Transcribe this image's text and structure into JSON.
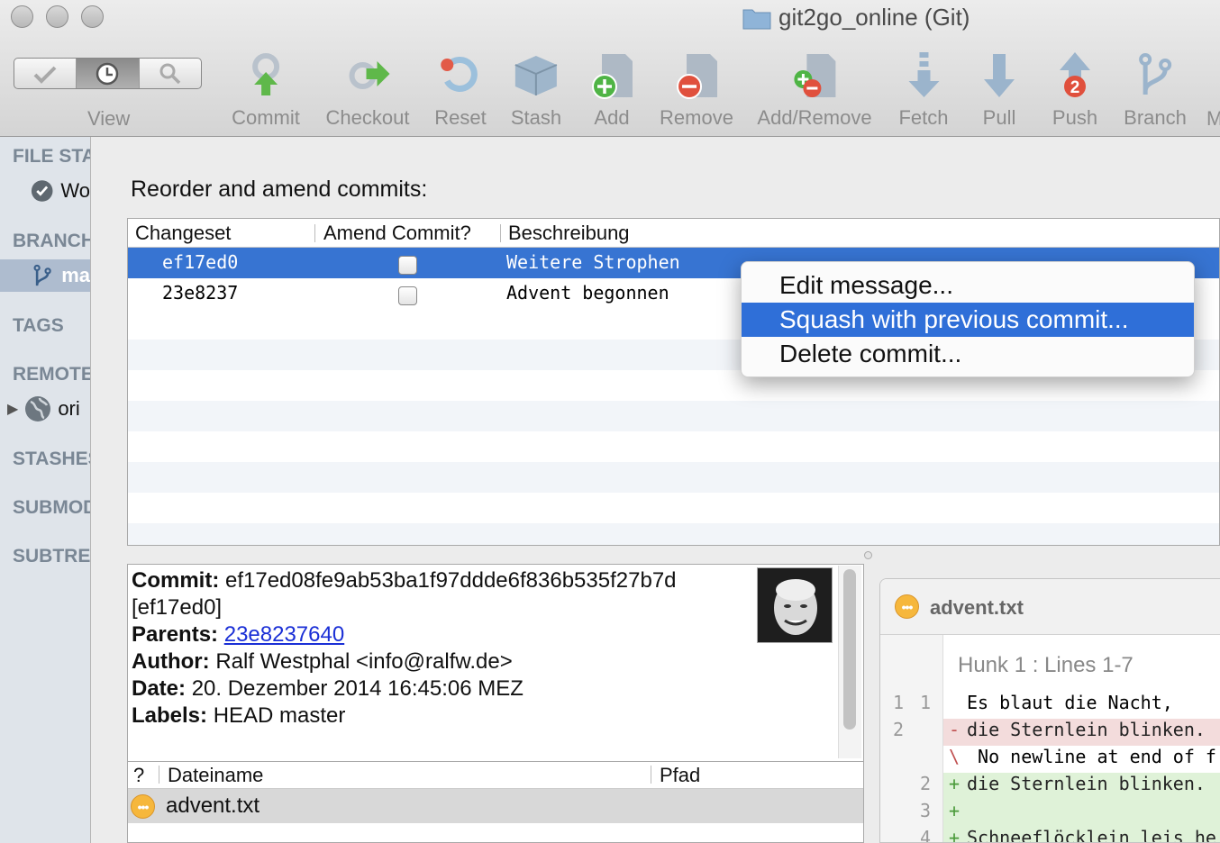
{
  "window": {
    "title": "git2go_online (Git)"
  },
  "toolbar": {
    "view_label": "View",
    "items": [
      {
        "label": "Commit",
        "icon": "commit-icon"
      },
      {
        "label": "Checkout",
        "icon": "checkout-icon"
      },
      {
        "label": "Reset",
        "icon": "reset-icon"
      },
      {
        "label": "Stash",
        "icon": "stash-icon"
      },
      {
        "label": "Add",
        "icon": "add-icon"
      },
      {
        "label": "Remove",
        "icon": "remove-icon"
      },
      {
        "label": "Add/Remove",
        "icon": "add-remove-icon"
      },
      {
        "label": "Fetch",
        "icon": "fetch-icon"
      },
      {
        "label": "Pull",
        "icon": "pull-icon"
      },
      {
        "label": "Push",
        "icon": "push-icon",
        "badge": "2"
      },
      {
        "label": "Branch",
        "icon": "branch-icon"
      },
      {
        "label": "M",
        "icon": "merge-icon"
      }
    ]
  },
  "sidebar": {
    "file_status": "FILE STATUS",
    "working_copy": "Wo",
    "branches": "BRANCHES",
    "branch_master": "ma",
    "tags": "TAGS",
    "remotes": "REMOTES",
    "origin": "ori",
    "stashes": "STASHES",
    "submodules": "SUBMODULES",
    "subtrees": "SUBTREES"
  },
  "dialog": {
    "heading": "Reorder and amend commits:",
    "columns": {
      "changeset": "Changeset",
      "amend": "Amend Commit?",
      "description": "Beschreibung"
    },
    "rows": [
      {
        "changeset": "ef17ed0",
        "description": "Weitere Strophen",
        "amend": false,
        "selected": true
      },
      {
        "changeset": "23e8237",
        "description": "Advent begonnen",
        "amend": false,
        "selected": false
      }
    ]
  },
  "context_menu": {
    "edit": "Edit message...",
    "squash": "Squash with previous commit...",
    "delete": "Delete commit..."
  },
  "commit_details": {
    "commit_label": "Commit:",
    "commit_hash": "ef17ed08fe9ab53ba1f97ddde6f836b535f27b7d",
    "commit_short": "[ef17ed0]",
    "parents_label": "Parents:",
    "parents_value": "23e8237640",
    "author_label": "Author:",
    "author_value": "Ralf Westphal <info@ralfw.de>",
    "date_label": "Date:",
    "date_value": "20. Dezember 2014 16:45:06 MEZ",
    "labels_label": "Labels:",
    "labels_value": "HEAD master"
  },
  "file_list": {
    "col_status": "?",
    "col_name": "Dateiname",
    "col_path": "Pfad",
    "files": [
      {
        "name": "advent.txt",
        "status": "modified"
      }
    ]
  },
  "diff": {
    "file": "advent.txt",
    "hunk": "Hunk 1 : Lines 1-7",
    "lines": [
      {
        "old": "1",
        "new": "1",
        "type": "context",
        "sign": "",
        "text": "Es blaut die Nacht,"
      },
      {
        "old": "2",
        "new": "",
        "type": "del",
        "sign": "-",
        "text": "die Sternlein blinken."
      },
      {
        "old": "",
        "new": "",
        "type": "meta",
        "sign": "\\",
        "text": "No newline at end of f"
      },
      {
        "old": "",
        "new": "2",
        "type": "add",
        "sign": "+",
        "text": "die Sternlein blinken."
      },
      {
        "old": "",
        "new": "3",
        "type": "add",
        "sign": "+",
        "text": ""
      },
      {
        "old": "",
        "new": "4",
        "type": "add",
        "sign": "+",
        "text": "Schneeflöcklein leis he"
      }
    ]
  }
}
